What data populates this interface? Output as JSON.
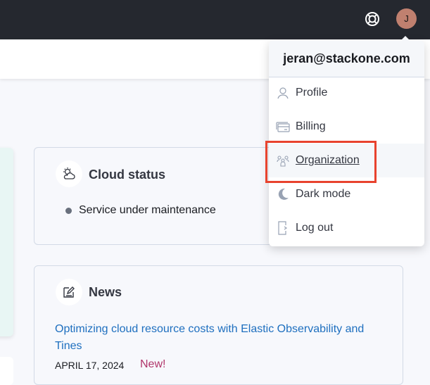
{
  "header": {
    "avatar_initial": "J",
    "help_icon": "lifebuoy-icon"
  },
  "cloud_status": {
    "title": "Cloud status",
    "status": "Service under maintenance"
  },
  "news": {
    "title": "News",
    "headline": "Optimizing cloud resource costs with Elastic Observability and Tines",
    "date": "APRIL 17, 2024",
    "badge": "New!"
  },
  "user_menu": {
    "email": "jeran@stackone.com",
    "items": [
      {
        "label": "Profile",
        "icon": "user-icon"
      },
      {
        "label": "Billing",
        "icon": "credit-card-icon"
      },
      {
        "label": "Organization",
        "icon": "users-icon"
      },
      {
        "label": "Dark mode",
        "icon": "moon-icon"
      },
      {
        "label": "Log out",
        "icon": "logout-icon"
      }
    ]
  },
  "colors": {
    "highlight": "#e8432e",
    "link": "#1e6fbf",
    "badge": "#b0356a"
  }
}
